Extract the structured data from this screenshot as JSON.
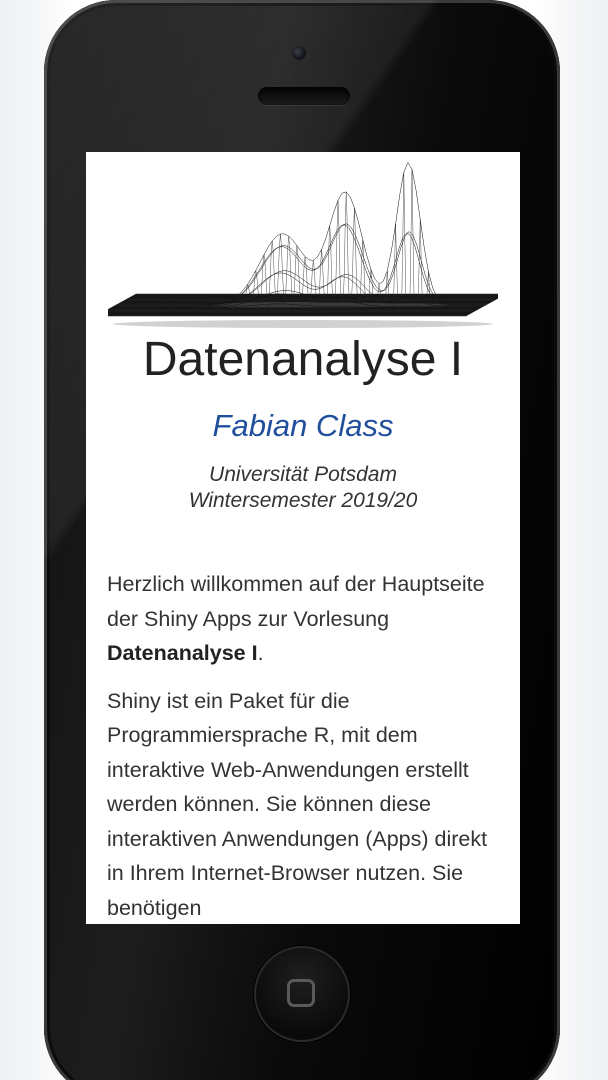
{
  "page": {
    "title": "Datenanalyse I",
    "author": "Fabian Class",
    "affiliation_line1": "Universität Potsdam",
    "affiliation_line2": "Wintersemester 2019/20"
  },
  "intro": {
    "p1_before": "Herzlich willkommen auf der Hauptseite der Shiny Apps zur Vorlesung ",
    "p1_bold": "Datenanalyse I",
    "p1_after": ".",
    "p2": "Shiny ist ein Paket für die Programmiersprache R, mit dem interaktive Web-Anwendungen erstellt werden können. Sie können diese interaktiven Anwendungen (Apps) direkt in Ihrem Internet-Browser nutzen. Sie benötigen"
  },
  "icons": {
    "home": "home-button-icon",
    "camera": "front-camera-icon",
    "speaker": "earpiece-speaker-icon",
    "hero": "3d-density-surface-logo"
  },
  "colors": {
    "author": "#1f4e9c",
    "text": "#333333",
    "phone_body": "#101010"
  }
}
